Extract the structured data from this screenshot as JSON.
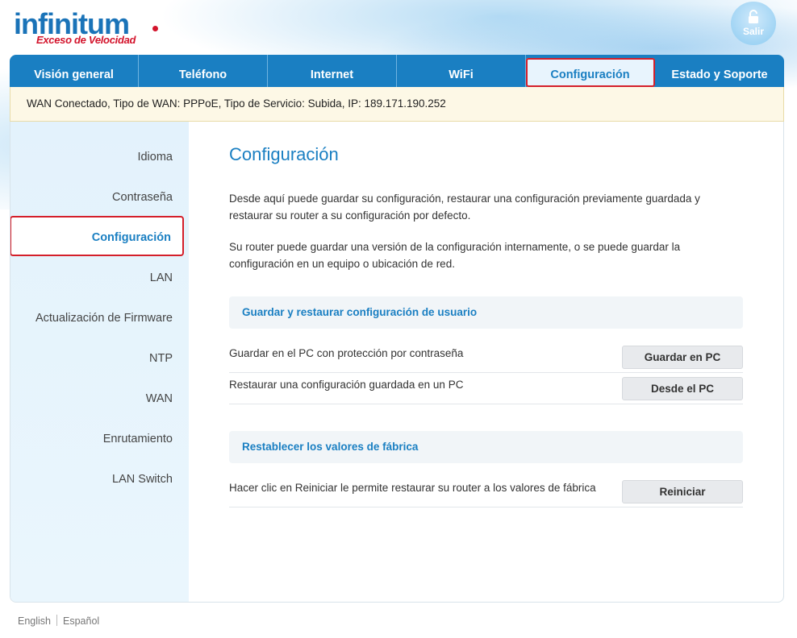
{
  "brand": {
    "name": "infinitum",
    "tagline": "Exceso de Velocidad"
  },
  "header": {
    "logout_label": "Salir"
  },
  "nav": {
    "tabs": [
      {
        "label": "Visión general"
      },
      {
        "label": "Teléfono"
      },
      {
        "label": "Internet"
      },
      {
        "label": "WiFi"
      },
      {
        "label": "Configuración",
        "active": true
      },
      {
        "label": "Estado y Soporte"
      }
    ]
  },
  "status": {
    "text": "WAN Conectado, Tipo de WAN: PPPoE, Tipo de Servicio: Subida, IP: 189.171.190.252"
  },
  "sidebar": {
    "items": [
      {
        "label": "Idioma"
      },
      {
        "label": "Contraseña"
      },
      {
        "label": "Configuración",
        "active": true
      },
      {
        "label": "LAN"
      },
      {
        "label": "Actualización de Firmware"
      },
      {
        "label": "NTP"
      },
      {
        "label": "WAN"
      },
      {
        "label": "Enrutamiento"
      },
      {
        "label": "LAN Switch"
      }
    ]
  },
  "main": {
    "title": "Configuración",
    "desc1": "Desde aquí puede guardar su configuración, restaurar una configuración previamente guardada y restaurar su router a su configuración por defecto.",
    "desc2": "Su router puede guardar una versión de la configuración internamente, o se puede guardar la configuración en un equipo o ubicación de red.",
    "section1": {
      "title": "Guardar y restaurar configuración de usuario",
      "rows": [
        {
          "label": "Guardar en el PC con protección por contraseña",
          "button": "Guardar en PC"
        },
        {
          "label": "Restaurar una configuración guardada en un PC",
          "button": "Desde el PC"
        }
      ]
    },
    "section2": {
      "title": "Restablecer los valores de fábrica",
      "rows": [
        {
          "label": "Hacer clic en Reiniciar le permite restaurar su router a los valores de fábrica",
          "button": "Reiniciar"
        }
      ]
    }
  },
  "footer": {
    "lang_en": "English",
    "lang_es": "Español"
  },
  "colors": {
    "accent": "#1a7fc2",
    "highlight": "#d41f2a",
    "status_bg": "#fdf8e6"
  }
}
